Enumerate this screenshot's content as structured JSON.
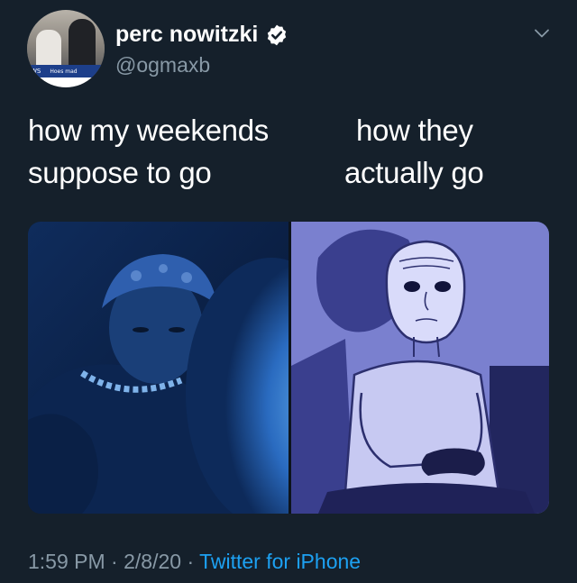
{
  "author": {
    "display_name": "perc nowitzki",
    "handle": "@ogmaxb",
    "verified": true,
    "avatar_banner_text": [
      "WS",
      "Hoes mad"
    ]
  },
  "tweet": {
    "caption_left": [
      "how my weekends",
      "suppose to go"
    ],
    "caption_right": [
      "how they",
      "actually go"
    ],
    "media": [
      {
        "description_icon": "blue-lit-person-photo"
      },
      {
        "description_icon": "wojak-gamer-drawing"
      }
    ]
  },
  "meta": {
    "time": "1:59 PM",
    "date": "2/8/20",
    "source": "Twitter for iPhone"
  },
  "colors": {
    "background": "#15202b",
    "secondary_text": "#8899a6",
    "link": "#1da1f2",
    "left_image_tint": "#1f4fa0",
    "right_image_tint": "#8a8fd8"
  }
}
